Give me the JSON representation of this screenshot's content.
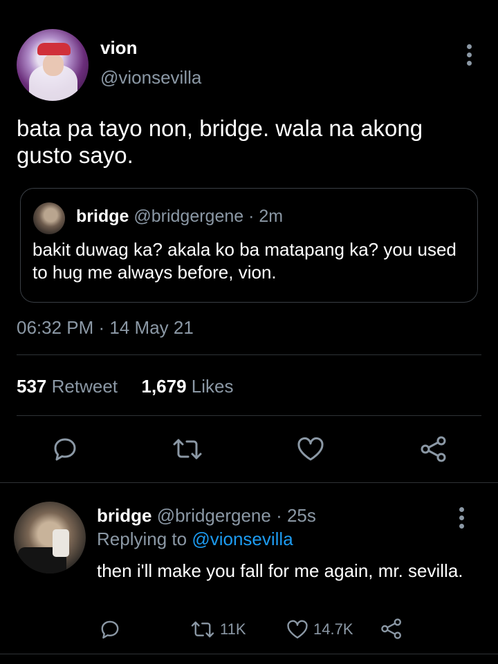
{
  "main_tweet": {
    "author_name": "vion",
    "author_handle": "@vionsevilla",
    "text": "bata pa tayo non, bridge. wala na akong gusto sayo.",
    "timestamp": "06:32 PM · 14 May 21"
  },
  "quoted_tweet": {
    "author_name": "bridge",
    "author_handle": "@bridgergene · 2m",
    "text": "bakit duwag ka? akala ko ba matapang ka? you used to hug me always before, vion."
  },
  "stats": {
    "retweets_count": "537",
    "retweets_label": "Retweet",
    "likes_count": "1,679",
    "likes_label": "Likes"
  },
  "actions": [
    "reply-icon",
    "retweet-icon",
    "like-icon",
    "share-icon"
  ],
  "reply": {
    "author_name": "bridge",
    "author_handle": "@bridgergene · 25s",
    "replying_to_label": "Replying to",
    "replying_to_handle": "@vionsevilla",
    "text": "then i'll make you fall for me again, mr. sevilla.",
    "retweets": "11K",
    "likes": "14.7K"
  },
  "colors": {
    "background": "#000000",
    "secondary_text": "#8b98a5",
    "link": "#1d9bf0",
    "divider": "#2f3336"
  }
}
